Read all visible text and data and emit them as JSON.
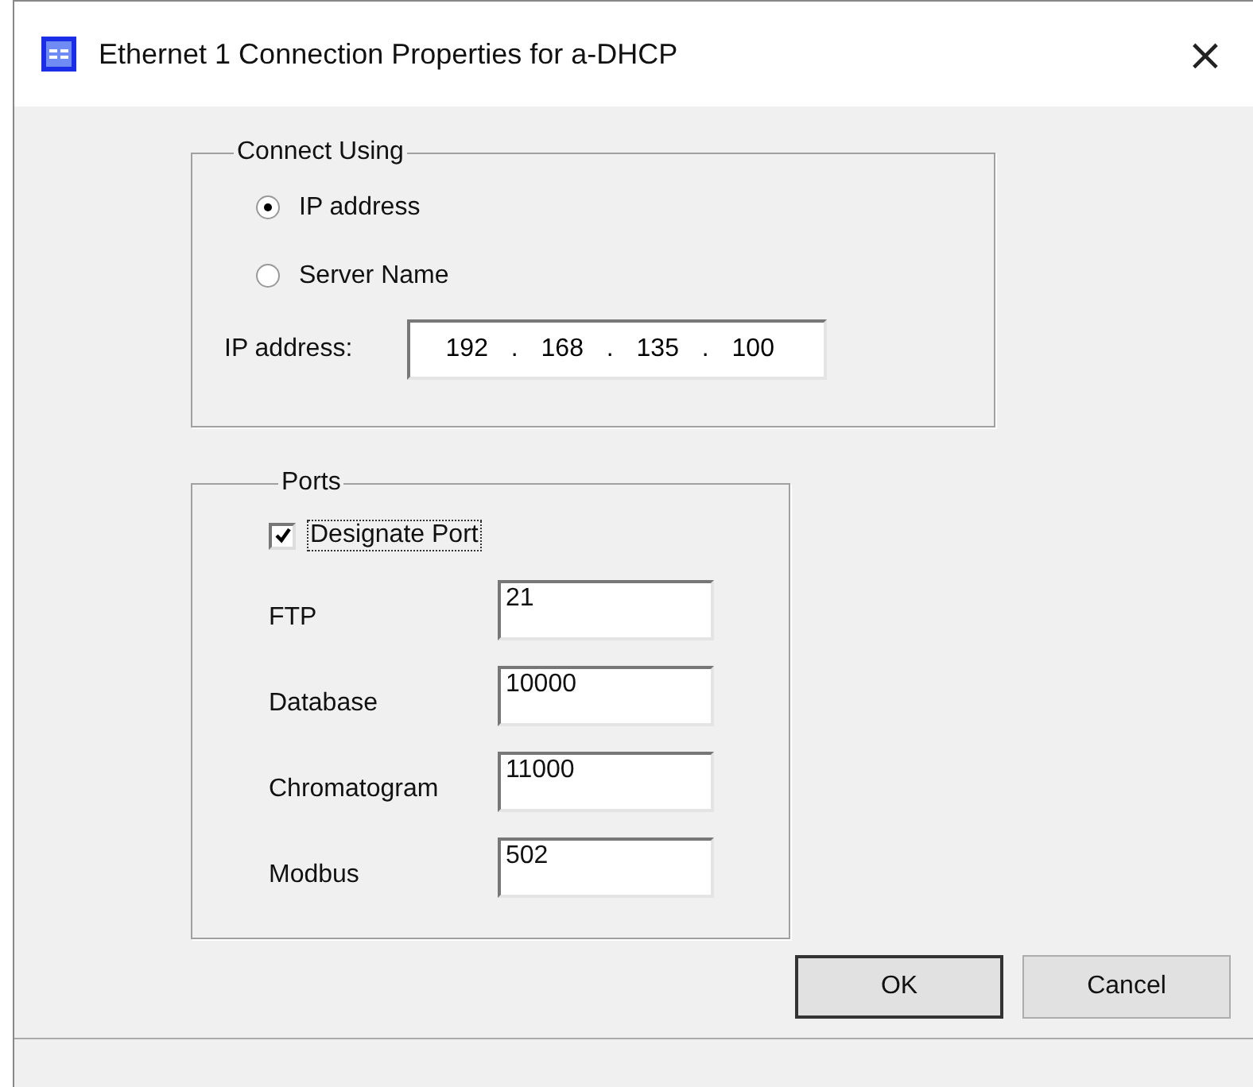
{
  "window": {
    "title": "Ethernet 1 Connection Properties for a-DHCP",
    "close": "×"
  },
  "connect_using": {
    "legend": "Connect Using",
    "options": [
      {
        "label": "IP address",
        "selected": true
      },
      {
        "label": "Server Name",
        "selected": false
      }
    ],
    "ip_label": "IP address:",
    "ip_octets": [
      "192",
      "168",
      "135",
      "100"
    ],
    "separator": "."
  },
  "ports": {
    "legend": "Ports",
    "designate": {
      "label": "Designate Port",
      "checked": true
    },
    "fields": [
      {
        "label": "FTP",
        "value": "21"
      },
      {
        "label": "Database",
        "value": "10000"
      },
      {
        "label": "Chromatogram",
        "value": "11000"
      },
      {
        "label": "Modbus",
        "value": "502"
      }
    ]
  },
  "buttons": [
    "OK",
    "Cancel"
  ]
}
